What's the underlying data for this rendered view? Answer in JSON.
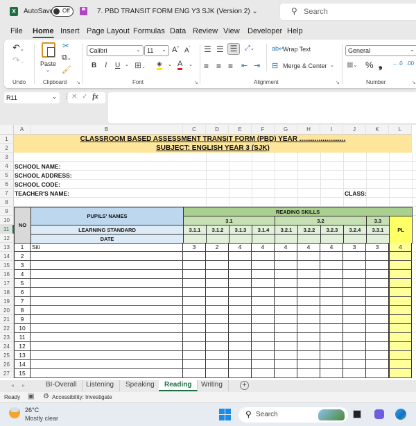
{
  "titlebar": {
    "app_icon": "excel-icon",
    "autosave_label": "AutoSave",
    "autosave_state": "Off",
    "document_title": "7. PBD TRANSIT FORM ENG Y3 SJK (Version 2) ⌄",
    "search_placeholder": "Search"
  },
  "menu": {
    "items": [
      "File",
      "Home",
      "Insert",
      "Page Layout",
      "Formulas",
      "Data",
      "Review",
      "View",
      "Developer",
      "Help"
    ],
    "active": "Home"
  },
  "ribbon": {
    "undo_group": "Undo",
    "clipboard_group": "Clipboard",
    "paste_label": "Paste",
    "font_group": "Font",
    "font_name": "Calibri",
    "font_size": "11",
    "alignment_group": "Alignment",
    "wrap_text": "Wrap Text",
    "merge_center": "Merge & Center",
    "number_group": "Number",
    "number_format": "General",
    "bold": "B",
    "italic": "I",
    "underline": "U",
    "percent": "%",
    "comma": "❟",
    "grow_font": "A^",
    "shrink_font": "Aˇ"
  },
  "formula_bar": {
    "name_box": "R11",
    "fx": "fx",
    "value": ""
  },
  "columns": [
    "A",
    "B",
    "C",
    "D",
    "E",
    "F",
    "G",
    "H",
    "I",
    "J",
    "K",
    "L"
  ],
  "rows": [
    "1",
    "2",
    "3",
    "4",
    "5",
    "6",
    "7",
    "8",
    "9",
    "10",
    "11",
    "12",
    "13",
    "14",
    "15",
    "16",
    "17",
    "18",
    "19",
    "20",
    "21",
    "22",
    "23",
    "24",
    "25",
    "26",
    "27"
  ],
  "sheet": {
    "title1": "CLASSROOM BASED ASSESSMENT TRANSIT FORM (PBD) YEAR ........................",
    "title2": "SUBJECT: ENGLISH YEAR 3 (SJK)",
    "school_name": "SCHOOL NAME:",
    "school_address": "SCHOOL ADDRESS:",
    "school_code": "SCHOOL CODE:",
    "teacher_name": "TEACHER'S NAME:",
    "class_label": "CLASS:",
    "no_header": "NO",
    "pupils_names": "PUPILS' NAMES",
    "learning_standard": "LEARNING STANDARD",
    "date": "DATE",
    "reading_skills": "READING SKILLS",
    "skill_groups": [
      "3.1",
      "3.2",
      "3.3"
    ],
    "standards": [
      "3.1.1",
      "3.1.2",
      "3.1.3",
      "3.1.4",
      "3.2.1",
      "3.2.2",
      "3.2.3",
      "3.2.4",
      "3.3.1"
    ],
    "pl_header": "PL",
    "pupils": [
      {
        "no": "1",
        "name": "Siti",
        "scores": [
          "3",
          "2",
          "4",
          "4",
          "4",
          "4",
          "4",
          "3",
          "3"
        ],
        "pl": "4"
      },
      {
        "no": "2",
        "name": "",
        "scores": [
          "",
          "",
          "",
          "",
          "",
          "",
          "",
          "",
          ""
        ],
        "pl": ""
      },
      {
        "no": "3",
        "name": "",
        "scores": [
          "",
          "",
          "",
          "",
          "",
          "",
          "",
          "",
          ""
        ],
        "pl": ""
      },
      {
        "no": "4",
        "name": "",
        "scores": [
          "",
          "",
          "",
          "",
          "",
          "",
          "",
          "",
          ""
        ],
        "pl": ""
      },
      {
        "no": "5",
        "name": "",
        "scores": [
          "",
          "",
          "",
          "",
          "",
          "",
          "",
          "",
          ""
        ],
        "pl": ""
      },
      {
        "no": "6",
        "name": "",
        "scores": [
          "",
          "",
          "",
          "",
          "",
          "",
          "",
          "",
          ""
        ],
        "pl": ""
      },
      {
        "no": "7",
        "name": "",
        "scores": [
          "",
          "",
          "",
          "",
          "",
          "",
          "",
          "",
          ""
        ],
        "pl": ""
      },
      {
        "no": "8",
        "name": "",
        "scores": [
          "",
          "",
          "",
          "",
          "",
          "",
          "",
          "",
          ""
        ],
        "pl": ""
      },
      {
        "no": "9",
        "name": "",
        "scores": [
          "",
          "",
          "",
          "",
          "",
          "",
          "",
          "",
          ""
        ],
        "pl": ""
      },
      {
        "no": "10",
        "name": "",
        "scores": [
          "",
          "",
          "",
          "",
          "",
          "",
          "",
          "",
          ""
        ],
        "pl": ""
      },
      {
        "no": "11",
        "name": "",
        "scores": [
          "",
          "",
          "",
          "",
          "",
          "",
          "",
          "",
          ""
        ],
        "pl": ""
      },
      {
        "no": "12",
        "name": "",
        "scores": [
          "",
          "",
          "",
          "",
          "",
          "",
          "",
          "",
          ""
        ],
        "pl": ""
      },
      {
        "no": "13",
        "name": "",
        "scores": [
          "",
          "",
          "",
          "",
          "",
          "",
          "",
          "",
          ""
        ],
        "pl": ""
      },
      {
        "no": "14",
        "name": "",
        "scores": [
          "",
          "",
          "",
          "",
          "",
          "",
          "",
          "",
          ""
        ],
        "pl": ""
      },
      {
        "no": "15",
        "name": "",
        "scores": [
          "",
          "",
          "",
          "",
          "",
          "",
          "",
          "",
          ""
        ],
        "pl": ""
      }
    ]
  },
  "tabs": {
    "items": [
      "BI-Overall",
      "Listening",
      "Speaking",
      "Reading",
      "Writing"
    ],
    "active": "Reading",
    "add_sheet": "+"
  },
  "status": {
    "ready": "Ready",
    "accessibility": "Accessibility: Investigate"
  },
  "taskbar": {
    "temperature": "26°C",
    "weather": "Mostly clear",
    "search": "Search"
  },
  "colors": {
    "excel_green": "#1d6f42",
    "banner": "#fde59b",
    "header_blue": "#bdd7ee",
    "header_blue_light": "#ddebf7",
    "skills_green": "#a9d08e",
    "skills_green_mid": "#c6e0b4",
    "skills_green_light": "#e2efda",
    "pl_yellow": "#ffff66",
    "pl_yellow_light": "#ffff99",
    "no_gray": "#d9d9d9"
  }
}
